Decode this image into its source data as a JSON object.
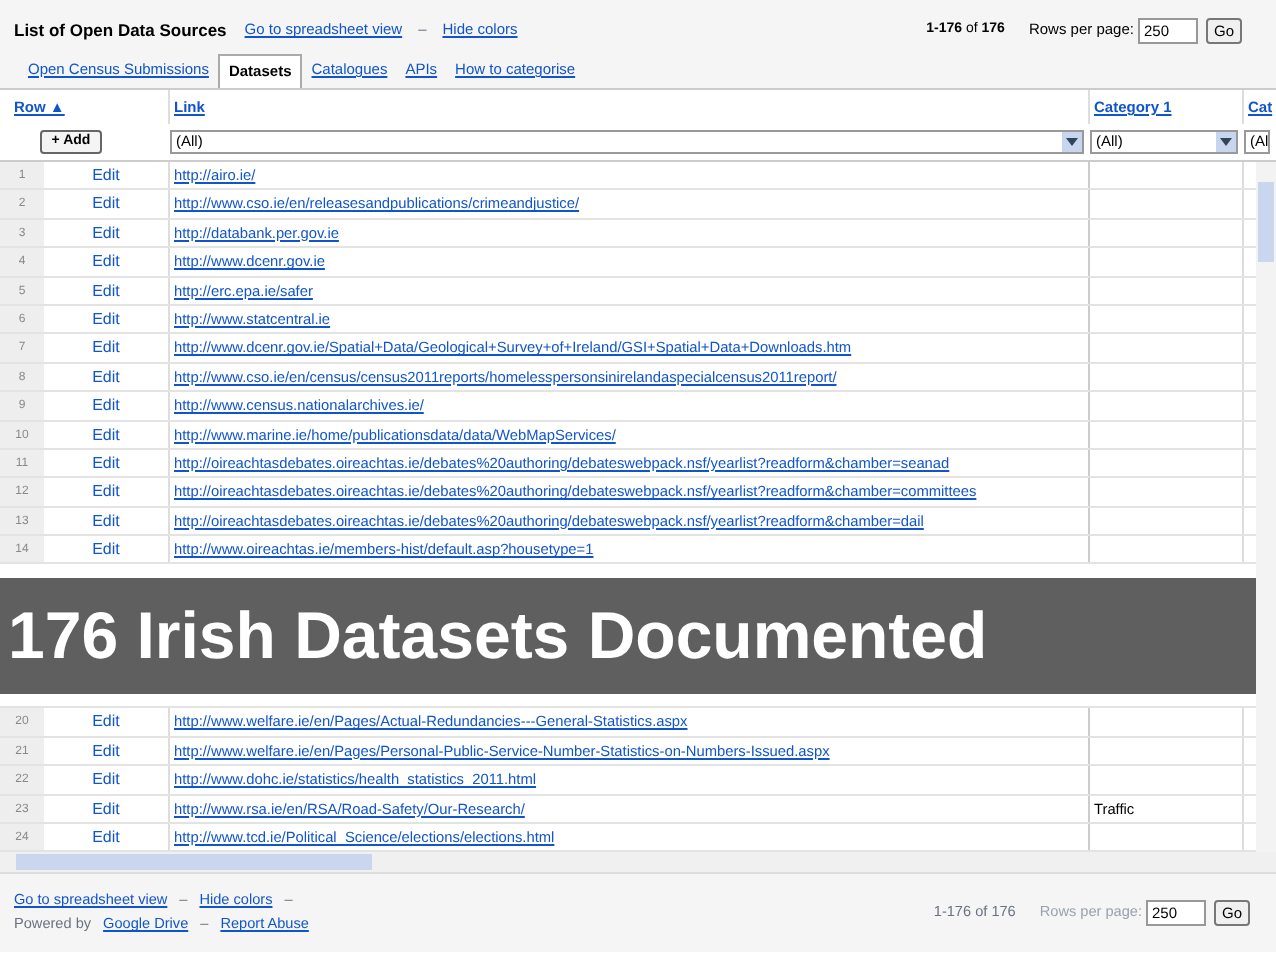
{
  "title": "List of Open Data Sources",
  "header_links": [
    {
      "kind": "link",
      "text": "Go to spreadsheet view"
    },
    {
      "kind": "separator",
      "text": "–"
    },
    {
      "kind": "link",
      "text": "Hide colors"
    }
  ],
  "pagination": {
    "range": "**1-176** of **176**",
    "rows_label": "Rows per page:",
    "rows_value": "250",
    "go": "Go"
  },
  "tabs": [
    {
      "label": "Open Census Submissions",
      "selected": false
    },
    {
      "label": "Datasets",
      "selected": true
    },
    {
      "label": "Catalogues",
      "selected": false
    },
    {
      "label": "APIs",
      "selected": false
    },
    {
      "label": "How to categorise",
      "selected": false
    }
  ],
  "columns": [
    "Row ▲",
    "Link",
    "Category 1",
    "Cat"
  ],
  "add_button": "+ Add",
  "filters": [
    "(All)",
    "(All)",
    "(Al"
  ],
  "rows": [
    {
      "number": "1",
      "action": "Edit",
      "link": "http://airo.ie/"
    },
    {
      "number": "2",
      "action": "Edit",
      "link": "http://www.cso.ie/en/releasesandpublications/crimeandjustice/"
    },
    {
      "number": "3",
      "action": "Edit",
      "link": "http://databank.per.gov.ie"
    },
    {
      "number": "4",
      "action": "Edit",
      "link": "http://www.dcenr.gov.ie"
    },
    {
      "number": "5",
      "action": "Edit",
      "link": "http://erc.epa.ie/safer"
    },
    {
      "number": "6",
      "action": "Edit",
      "link": "http://www.statcentral.ie"
    },
    {
      "number": "7",
      "action": "Edit",
      "link": "http://www.dcenr.gov.ie/Spatial+Data/Geological+Survey+of+Ireland/GSI+Spatial+Data+Downloads.htm"
    },
    {
      "number": "8",
      "action": "Edit",
      "link": "http://www.cso.ie/en/census/census2011reports/homelesspersonsinirelandaspecialcensus2011report/"
    },
    {
      "number": "9",
      "action": "Edit",
      "link": "http://www.census.nationalarchives.ie/"
    },
    {
      "number": "10",
      "action": "Edit",
      "link": "http://www.marine.ie/home/publicationsdata/data/WebMapServices/"
    },
    {
      "number": "11",
      "action": "Edit",
      "link": "http://oireachtasdebates.oireachtas.ie/debates%20authoring/debateswebpack.nsf/yearlist?readform&chamber=seanad"
    },
    {
      "number": "12",
      "action": "Edit",
      "link": "http://oireachtasdebates.oireachtas.ie/debates%20authoring/debateswebpack.nsf/yearlist?readform&chamber=committees"
    },
    {
      "number": "13",
      "action": "Edit",
      "link": "http://oireachtasdebates.oireachtas.ie/debates%20authoring/debateswebpack.nsf/yearlist?readform&chamber=dail"
    },
    {
      "number": "14",
      "action": "Edit",
      "link": "http://www.oireachtas.ie/members-hist/default.asp?housetype=1"
    }
  ],
  "banner": "176 Irish Datasets Documented",
  "rows_after": [
    {
      "number": "20",
      "action": "Edit",
      "link": "http://www.welfare.ie/en/Pages/Actual-Redundancies---General-Statistics.aspx"
    },
    {
      "number": "21",
      "action": "Edit",
      "link": "http://www.welfare.ie/en/Pages/Personal-Public-Service-Number-Statistics-on-Numbers-Issued.aspx"
    },
    {
      "number": "22",
      "action": "Edit",
      "link": "http://www.dohc.ie/statistics/health_statistics_2011.html"
    },
    {
      "number": "23",
      "action": "Edit",
      "link": "http://www.rsa.ie/en/RSA/Road-Safety/Our-Research/",
      "category_1": "Traffic"
    },
    {
      "number": "24",
      "action": "Edit",
      "link": "http://www.tcd.ie/Political_Science/elections/elections.html"
    }
  ],
  "footer": {
    "line_1": [
      {
        "kind": "link",
        "text": "Go to spreadsheet view"
      },
      {
        "kind": "separator",
        "text": "–"
      },
      {
        "kind": "link",
        "text": "Hide colors"
      },
      {
        "kind": "separator",
        "text": "–"
      }
    ],
    "line_2": [
      {
        "kind": "plain",
        "text": "Powered by"
      },
      {
        "kind": "link",
        "text": "Google Drive"
      },
      {
        "kind": "separator",
        "text": "–"
      },
      {
        "kind": "link",
        "text": "Report Abuse"
      }
    ]
  },
  "footer_pagination": {
    "range": "1-176 of 176",
    "rows_label": "Rows per page:",
    "rows_value": "250",
    "go": "Go"
  }
}
